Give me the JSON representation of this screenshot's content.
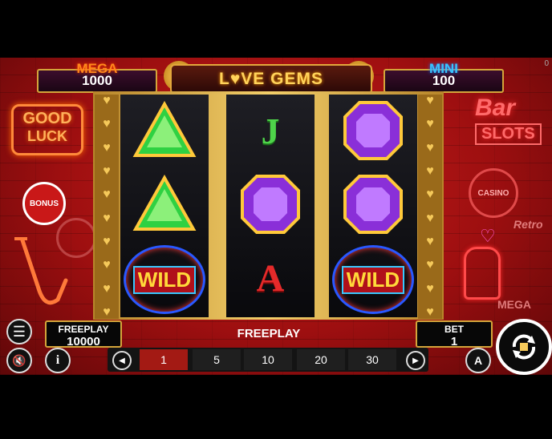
{
  "game": {
    "title": "L♥VE GEMS"
  },
  "jackpots": {
    "mega": {
      "label": "MEGA",
      "value": "1000"
    },
    "mini": {
      "label": "MINI",
      "value": "100"
    }
  },
  "corner_counter": "0",
  "neon": {
    "good": "GOOD",
    "luck": "LUCK",
    "bonus": "BONUS",
    "bar": "Bar",
    "slots": "SLOTS",
    "casino": "CASINO",
    "retro": "Retro",
    "mega_sign": "MEGA"
  },
  "reels": [
    [
      "green-gem",
      "green-gem",
      "wild"
    ],
    [
      "J",
      "purple-gem",
      "A"
    ],
    [
      "purple-gem",
      "purple-gem",
      "wild"
    ]
  ],
  "symbols": {
    "wild": "WILD",
    "j": "J",
    "a": "A"
  },
  "status": {
    "freeplay_label": "FREEPLAY",
    "freeplay_value": "10000",
    "center_text": "FREEPLAY"
  },
  "bet": {
    "label": "BET",
    "value": "1",
    "options": [
      "1",
      "5",
      "10",
      "20",
      "30"
    ],
    "selected_index": 0
  },
  "icons": {
    "menu": "menu-icon",
    "sound": "speaker-muted-icon",
    "info": "info-icon",
    "prev": "triangle-left-icon",
    "next": "triangle-right-icon",
    "auto": "autoplay-icon",
    "spin": "spin-icon"
  },
  "colors": {
    "accent_gold": "#d4a53a",
    "mega": "#ff8a1c",
    "mini": "#38c4ff",
    "selected_bet": "#a31a14"
  }
}
